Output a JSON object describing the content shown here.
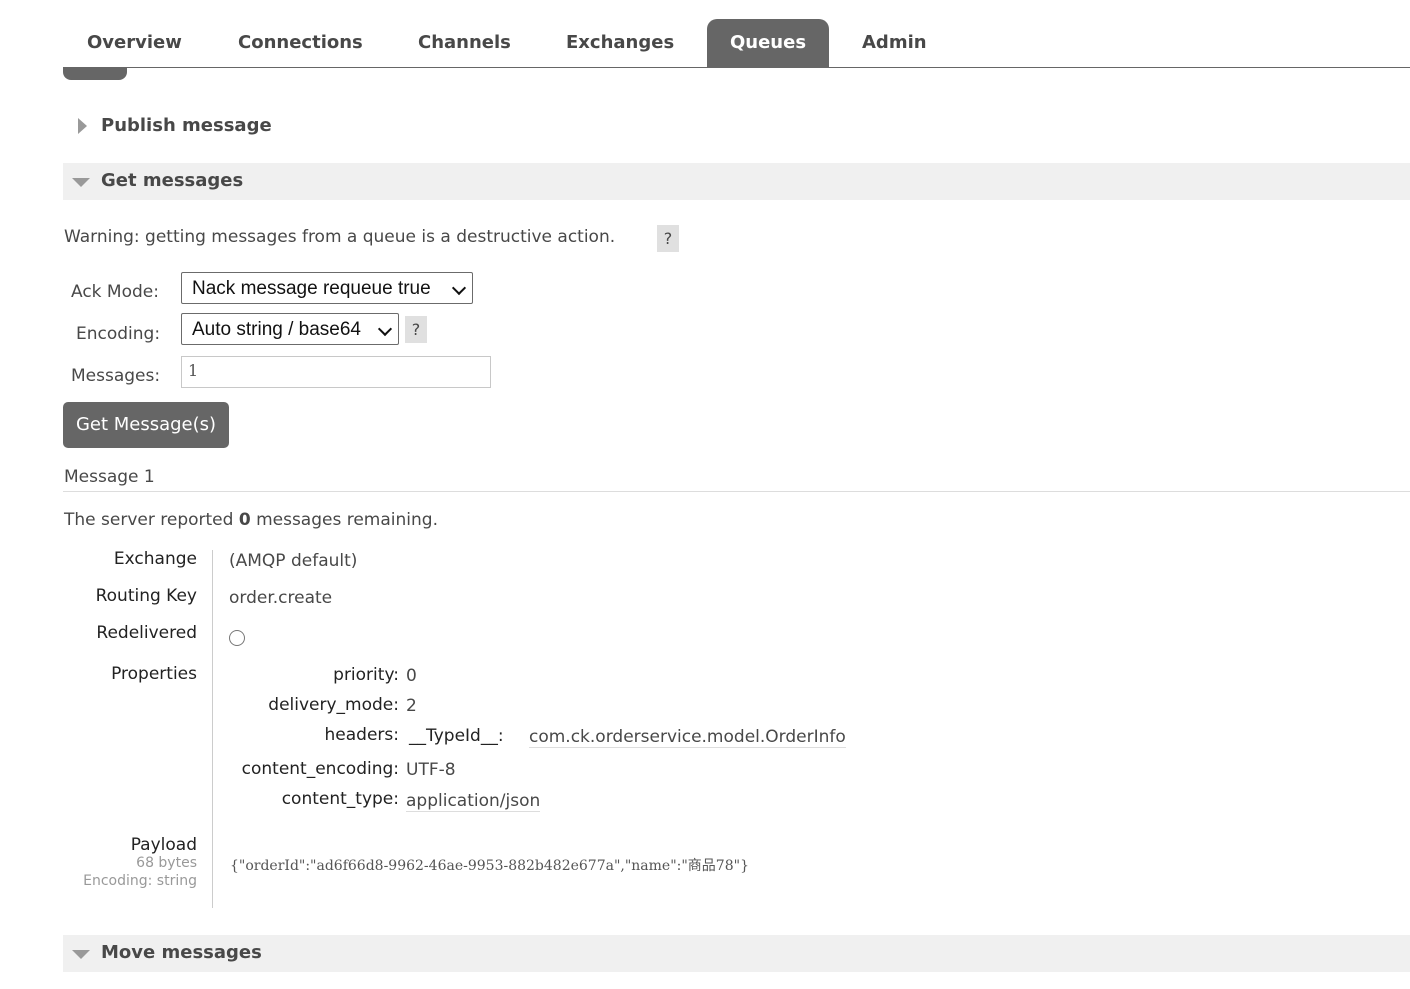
{
  "nav": {
    "tabs": [
      "Overview",
      "Connections",
      "Channels",
      "Exchanges",
      "Queues",
      "Admin"
    ],
    "active": "Queues"
  },
  "publish": {
    "title": "Publish message"
  },
  "get": {
    "title": "Get messages",
    "warning": "Warning: getting messages from a queue is a destructive action.",
    "help": "?",
    "ack_label": "Ack Mode:",
    "ack_value": "Nack message requeue true",
    "encoding_label": "Encoding:",
    "encoding_value": "Auto string / base64",
    "messages_label": "Messages:",
    "messages_value": "1",
    "button": "Get Message(s)"
  },
  "result": {
    "heading": "Message 1",
    "server_prefix": "The server reported ",
    "remaining": "0",
    "server_suffix": " messages remaining.",
    "exchange_label": "Exchange",
    "exchange_value": "(AMQP default)",
    "routing_key_label": "Routing Key",
    "routing_key_value": "order.create",
    "redelivered_label": "Redelivered",
    "properties_label": "Properties",
    "properties": {
      "priority_label": "priority:",
      "priority_value": "0",
      "delivery_mode_label": "delivery_mode:",
      "delivery_mode_value": "2",
      "headers_label": "headers:",
      "header_key": "__TypeId__:",
      "header_value": "com.ck.orderservice.model.OrderInfo",
      "content_encoding_label": "content_encoding:",
      "content_encoding_value": "UTF-8",
      "content_type_label": "content_type:",
      "content_type_value": "application/json"
    },
    "payload_label": "Payload",
    "payload_size": "68 bytes",
    "payload_encoding": "Encoding: string",
    "payload_value": "{\"orderId\":\"ad6f66d8-9962-46ae-9953-882b482e677a\",\"name\":\"商品78\"}"
  },
  "move": {
    "title": "Move messages"
  }
}
